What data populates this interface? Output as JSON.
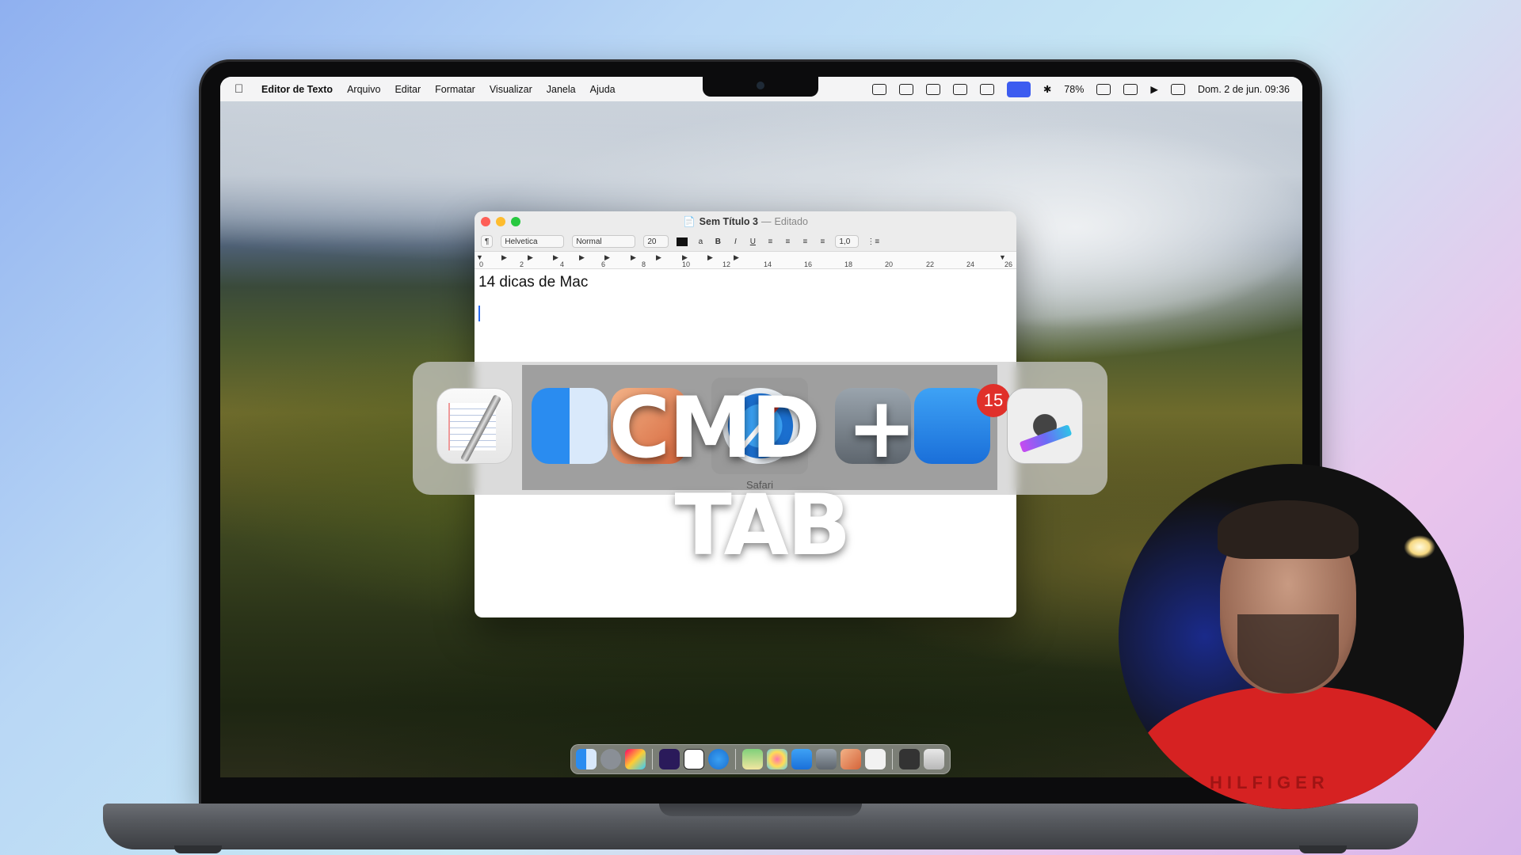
{
  "menubar": {
    "app_name": "Editor de Texto",
    "menus": [
      "Arquivo",
      "Editar",
      "Formatar",
      "Visualizar",
      "Janela",
      "Ajuda"
    ],
    "battery": "78%",
    "datetime": "Dom. 2 de jun.  09:36"
  },
  "window": {
    "title": "Sem Título 3",
    "status": "Editado",
    "toolbar": {
      "paragraph": "¶",
      "font": "Helvetica",
      "style": "Normal",
      "size": "20",
      "bold": "B",
      "italic": "I",
      "underline": "U",
      "spacing": "1,0"
    },
    "ruler_ticks": [
      "0",
      "2",
      "4",
      "6",
      "8",
      "10",
      "12",
      "14",
      "16",
      "18",
      "20",
      "22",
      "24",
      "26"
    ],
    "document_text": "14 dicas de Mac"
  },
  "switcher": {
    "overlay_text": "CMD + TAB",
    "selected_app": "Safari",
    "mail_badge": "15"
  },
  "webcam": {
    "shirt_text": "HILFIGER"
  },
  "colors": {
    "accent": "#3c5cf0",
    "badge": "#e0302a",
    "shirt": "#d62222"
  }
}
